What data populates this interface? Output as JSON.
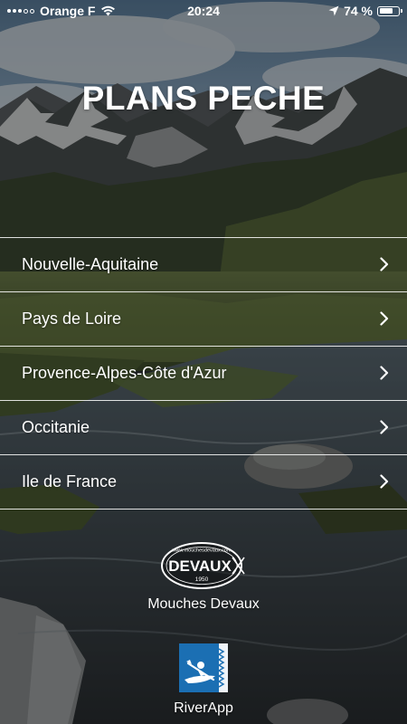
{
  "status_bar": {
    "carrier": "Orange F",
    "time": "20:24",
    "battery_text": "74 %",
    "battery_level": 0.74,
    "signal_bars_filled": 3,
    "signal_bars_total": 5
  },
  "header": {
    "title": "PLANS PECHE"
  },
  "regions": [
    {
      "label": "Nouvelle-Aquitaine"
    },
    {
      "label": "Pays de Loire"
    },
    {
      "label": "Provence-Alpes-Côte d'Azur"
    },
    {
      "label": "Occitanie"
    },
    {
      "label": "Ile de France"
    }
  ],
  "partners": {
    "devaux": {
      "label": "Mouches Devaux",
      "logo_text": "DEVAUX",
      "logo_year": "1950",
      "logo_url_text": "www.mouchesdevaux.com"
    },
    "riverapp": {
      "label": "RiverApp"
    }
  },
  "colors": {
    "riverapp_blue": "#1b6fb3",
    "separator": "#ffffff",
    "text": "#ffffff"
  },
  "icons": {
    "status": [
      "signal-dots-icon",
      "wifi-icon",
      "location-arrow-icon",
      "battery-icon"
    ],
    "row_chevron": "chevron-right-icon",
    "riverapp": "kayak-icon"
  }
}
